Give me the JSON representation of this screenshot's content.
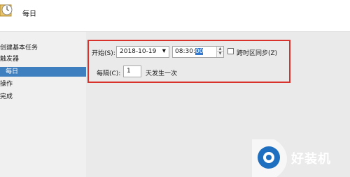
{
  "header": {
    "title": "每日",
    "icon": "calendar-clock-icon"
  },
  "steps": [
    {
      "label": "创建基本任务",
      "active": false
    },
    {
      "label": "触发器",
      "active": false
    },
    {
      "label": "每日",
      "active": true
    },
    {
      "label": "操作",
      "active": false
    },
    {
      "label": "完成",
      "active": false
    }
  ],
  "form": {
    "start_label": "开始(S):",
    "start_date": "2018-10-19",
    "start_time_prefix": "08:30:",
    "start_time_selected": "00",
    "sync_label": "跨时区同步(Z)",
    "sync_checked": false,
    "every_label": "每隔(C):",
    "every_value": "1",
    "every_unit": "天发生一次"
  },
  "watermark": {
    "text": "好装机",
    "icon": "watermark-logo-icon"
  },
  "colors": {
    "active_step": "#3e7fbf",
    "highlight_border": "#d9312b",
    "selection": "#3078d0"
  }
}
